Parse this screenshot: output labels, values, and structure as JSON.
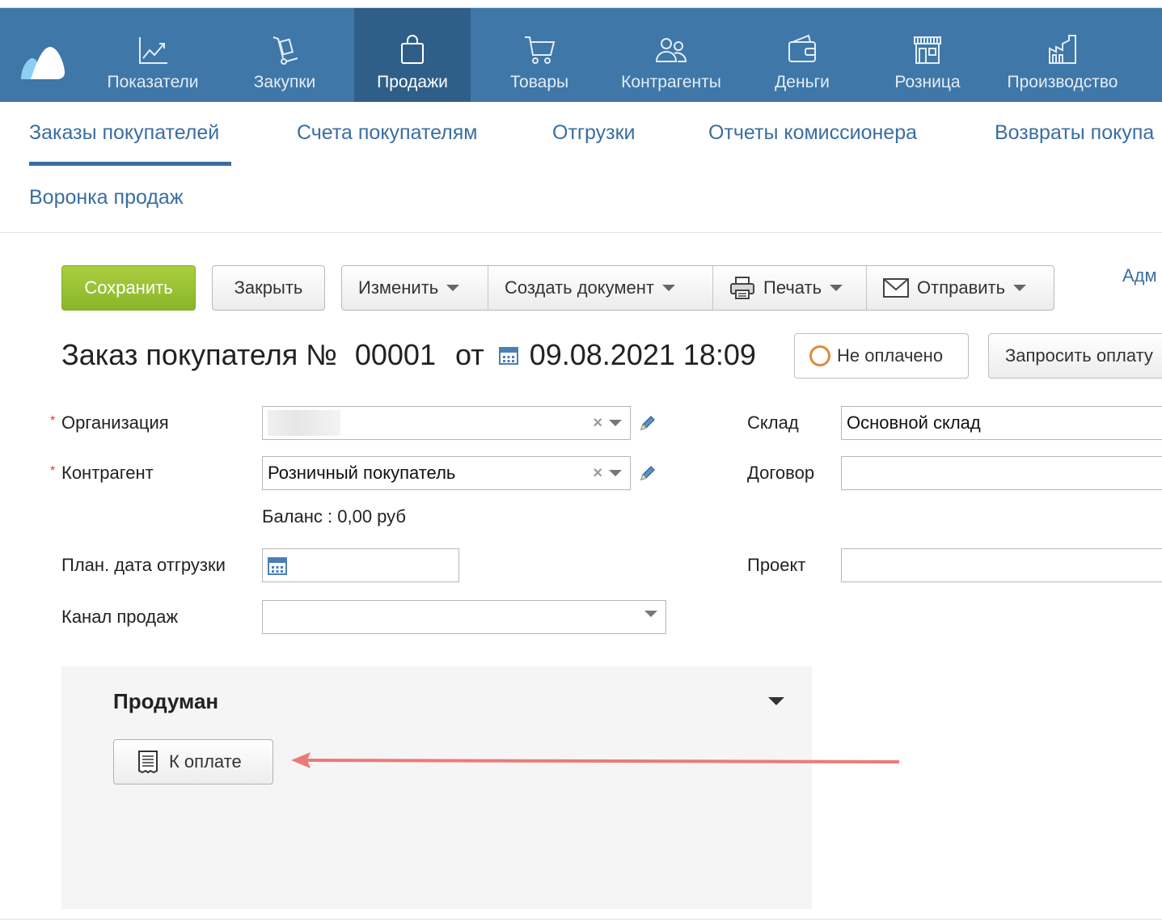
{
  "topnav": {
    "items": [
      {
        "label": "Показатели",
        "icon": "chart-line-icon"
      },
      {
        "label": "Закупки",
        "icon": "hand-truck-icon"
      },
      {
        "label": "Продажи",
        "icon": "shopping-bag-icon",
        "active": true
      },
      {
        "label": "Товары",
        "icon": "cart-icon"
      },
      {
        "label": "Контрагенты",
        "icon": "users-icon"
      },
      {
        "label": "Деньги",
        "icon": "wallet-icon"
      },
      {
        "label": "Розница",
        "icon": "store-icon"
      },
      {
        "label": "Производство",
        "icon": "factory-icon"
      }
    ],
    "bg_color": "#3f77a8",
    "active_color": "#2f5f88"
  },
  "subnav": {
    "items": [
      {
        "label": "Заказы покупателей",
        "active": true
      },
      {
        "label": "Счета покупателям"
      },
      {
        "label": "Отгрузки"
      },
      {
        "label": "Отчеты комиссионера"
      },
      {
        "label": "Возвраты покупа"
      },
      {
        "label": "Воронка продаж"
      }
    ]
  },
  "toolbar": {
    "save_label": "Сохранить",
    "close_label": "Закрыть",
    "edit_label": "Изменить",
    "create_doc_label": "Создать документ",
    "print_label": "Печать",
    "send_label": "Отправить",
    "admin_link": "Адм"
  },
  "order": {
    "title": "Заказ покупателя №",
    "number": "00001",
    "from_label": "от",
    "datetime": "09.08.2021 18:09",
    "status": "Не оплачено",
    "request_payment": "Запросить оплату"
  },
  "form": {
    "organization_label": "Организация",
    "organization_value": "",
    "counterparty_label": "Контрагент",
    "counterparty_value": "Розничный покупатель",
    "balance_text": "Баланс : 0,00 руб",
    "ship_date_label": "План. дата отгрузки",
    "ship_date_value": "",
    "sales_channel_label": "Канал продаж",
    "sales_channel_value": "",
    "warehouse_label": "Склад",
    "warehouse_value": "Основной склад",
    "contract_label": "Договор",
    "contract_value": "",
    "project_label": "Проект",
    "project_value": ""
  },
  "panel": {
    "title": "Продуман",
    "pay_button": "К оплате"
  },
  "colors": {
    "accent": "#3a6ea0",
    "save_green": "#9bc234",
    "status_orange": "#e08a3c",
    "arrow_red": "#ec7a78"
  }
}
